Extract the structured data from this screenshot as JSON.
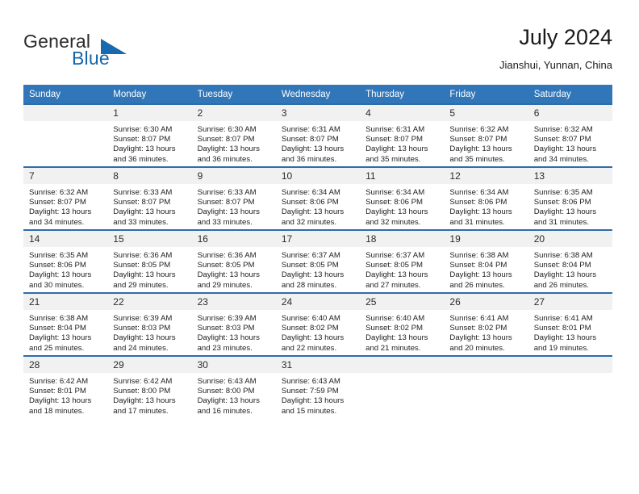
{
  "brand": {
    "word1": "General",
    "word2": "Blue",
    "triangle_color": "#1769b0"
  },
  "header": {
    "title": "July 2024",
    "location": "Jianshui, Yunnan, China"
  },
  "theme": {
    "header_bg": "#3076b8",
    "row_divider": "#2e6da8",
    "daynum_bg": "#f1f1f1",
    "brand_blue": "#1464aa"
  },
  "weekdays": [
    "Sunday",
    "Monday",
    "Tuesday",
    "Wednesday",
    "Thursday",
    "Friday",
    "Saturday"
  ],
  "labels": {
    "sunrise_prefix": "Sunrise: ",
    "sunset_prefix": "Sunset: ",
    "daylight_prefix": "Daylight: "
  },
  "weeks": [
    [
      {
        "day": "",
        "blank": true,
        "sunrise": "",
        "sunset": "",
        "daylight_line1": "",
        "daylight_line2": ""
      },
      {
        "day": "1",
        "sunrise": "Sunrise: 6:30 AM",
        "sunset": "Sunset: 8:07 PM",
        "daylight_line1": "Daylight: 13 hours",
        "daylight_line2": "and 36 minutes."
      },
      {
        "day": "2",
        "sunrise": "Sunrise: 6:30 AM",
        "sunset": "Sunset: 8:07 PM",
        "daylight_line1": "Daylight: 13 hours",
        "daylight_line2": "and 36 minutes."
      },
      {
        "day": "3",
        "sunrise": "Sunrise: 6:31 AM",
        "sunset": "Sunset: 8:07 PM",
        "daylight_line1": "Daylight: 13 hours",
        "daylight_line2": "and 36 minutes."
      },
      {
        "day": "4",
        "sunrise": "Sunrise: 6:31 AM",
        "sunset": "Sunset: 8:07 PM",
        "daylight_line1": "Daylight: 13 hours",
        "daylight_line2": "and 35 minutes."
      },
      {
        "day": "5",
        "sunrise": "Sunrise: 6:32 AM",
        "sunset": "Sunset: 8:07 PM",
        "daylight_line1": "Daylight: 13 hours",
        "daylight_line2": "and 35 minutes."
      },
      {
        "day": "6",
        "sunrise": "Sunrise: 6:32 AM",
        "sunset": "Sunset: 8:07 PM",
        "daylight_line1": "Daylight: 13 hours",
        "daylight_line2": "and 34 minutes."
      }
    ],
    [
      {
        "day": "7",
        "sunrise": "Sunrise: 6:32 AM",
        "sunset": "Sunset: 8:07 PM",
        "daylight_line1": "Daylight: 13 hours",
        "daylight_line2": "and 34 minutes."
      },
      {
        "day": "8",
        "sunrise": "Sunrise: 6:33 AM",
        "sunset": "Sunset: 8:07 PM",
        "daylight_line1": "Daylight: 13 hours",
        "daylight_line2": "and 33 minutes."
      },
      {
        "day": "9",
        "sunrise": "Sunrise: 6:33 AM",
        "sunset": "Sunset: 8:07 PM",
        "daylight_line1": "Daylight: 13 hours",
        "daylight_line2": "and 33 minutes."
      },
      {
        "day": "10",
        "sunrise": "Sunrise: 6:34 AM",
        "sunset": "Sunset: 8:06 PM",
        "daylight_line1": "Daylight: 13 hours",
        "daylight_line2": "and 32 minutes."
      },
      {
        "day": "11",
        "sunrise": "Sunrise: 6:34 AM",
        "sunset": "Sunset: 8:06 PM",
        "daylight_line1": "Daylight: 13 hours",
        "daylight_line2": "and 32 minutes."
      },
      {
        "day": "12",
        "sunrise": "Sunrise: 6:34 AM",
        "sunset": "Sunset: 8:06 PM",
        "daylight_line1": "Daylight: 13 hours",
        "daylight_line2": "and 31 minutes."
      },
      {
        "day": "13",
        "sunrise": "Sunrise: 6:35 AM",
        "sunset": "Sunset: 8:06 PM",
        "daylight_line1": "Daylight: 13 hours",
        "daylight_line2": "and 31 minutes."
      }
    ],
    [
      {
        "day": "14",
        "sunrise": "Sunrise: 6:35 AM",
        "sunset": "Sunset: 8:06 PM",
        "daylight_line1": "Daylight: 13 hours",
        "daylight_line2": "and 30 minutes."
      },
      {
        "day": "15",
        "sunrise": "Sunrise: 6:36 AM",
        "sunset": "Sunset: 8:05 PM",
        "daylight_line1": "Daylight: 13 hours",
        "daylight_line2": "and 29 minutes."
      },
      {
        "day": "16",
        "sunrise": "Sunrise: 6:36 AM",
        "sunset": "Sunset: 8:05 PM",
        "daylight_line1": "Daylight: 13 hours",
        "daylight_line2": "and 29 minutes."
      },
      {
        "day": "17",
        "sunrise": "Sunrise: 6:37 AM",
        "sunset": "Sunset: 8:05 PM",
        "daylight_line1": "Daylight: 13 hours",
        "daylight_line2": "and 28 minutes."
      },
      {
        "day": "18",
        "sunrise": "Sunrise: 6:37 AM",
        "sunset": "Sunset: 8:05 PM",
        "daylight_line1": "Daylight: 13 hours",
        "daylight_line2": "and 27 minutes."
      },
      {
        "day": "19",
        "sunrise": "Sunrise: 6:38 AM",
        "sunset": "Sunset: 8:04 PM",
        "daylight_line1": "Daylight: 13 hours",
        "daylight_line2": "and 26 minutes."
      },
      {
        "day": "20",
        "sunrise": "Sunrise: 6:38 AM",
        "sunset": "Sunset: 8:04 PM",
        "daylight_line1": "Daylight: 13 hours",
        "daylight_line2": "and 26 minutes."
      }
    ],
    [
      {
        "day": "21",
        "sunrise": "Sunrise: 6:38 AM",
        "sunset": "Sunset: 8:04 PM",
        "daylight_line1": "Daylight: 13 hours",
        "daylight_line2": "and 25 minutes."
      },
      {
        "day": "22",
        "sunrise": "Sunrise: 6:39 AM",
        "sunset": "Sunset: 8:03 PM",
        "daylight_line1": "Daylight: 13 hours",
        "daylight_line2": "and 24 minutes."
      },
      {
        "day": "23",
        "sunrise": "Sunrise: 6:39 AM",
        "sunset": "Sunset: 8:03 PM",
        "daylight_line1": "Daylight: 13 hours",
        "daylight_line2": "and 23 minutes."
      },
      {
        "day": "24",
        "sunrise": "Sunrise: 6:40 AM",
        "sunset": "Sunset: 8:02 PM",
        "daylight_line1": "Daylight: 13 hours",
        "daylight_line2": "and 22 minutes."
      },
      {
        "day": "25",
        "sunrise": "Sunrise: 6:40 AM",
        "sunset": "Sunset: 8:02 PM",
        "daylight_line1": "Daylight: 13 hours",
        "daylight_line2": "and 21 minutes."
      },
      {
        "day": "26",
        "sunrise": "Sunrise: 6:41 AM",
        "sunset": "Sunset: 8:02 PM",
        "daylight_line1": "Daylight: 13 hours",
        "daylight_line2": "and 20 minutes."
      },
      {
        "day": "27",
        "sunrise": "Sunrise: 6:41 AM",
        "sunset": "Sunset: 8:01 PM",
        "daylight_line1": "Daylight: 13 hours",
        "daylight_line2": "and 19 minutes."
      }
    ],
    [
      {
        "day": "28",
        "sunrise": "Sunrise: 6:42 AM",
        "sunset": "Sunset: 8:01 PM",
        "daylight_line1": "Daylight: 13 hours",
        "daylight_line2": "and 18 minutes."
      },
      {
        "day": "29",
        "sunrise": "Sunrise: 6:42 AM",
        "sunset": "Sunset: 8:00 PM",
        "daylight_line1": "Daylight: 13 hours",
        "daylight_line2": "and 17 minutes."
      },
      {
        "day": "30",
        "sunrise": "Sunrise: 6:43 AM",
        "sunset": "Sunset: 8:00 PM",
        "daylight_line1": "Daylight: 13 hours",
        "daylight_line2": "and 16 minutes."
      },
      {
        "day": "31",
        "sunrise": "Sunrise: 6:43 AM",
        "sunset": "Sunset: 7:59 PM",
        "daylight_line1": "Daylight: 13 hours",
        "daylight_line2": "and 15 minutes."
      },
      {
        "day": "",
        "blank": true,
        "sunrise": "",
        "sunset": "",
        "daylight_line1": "",
        "daylight_line2": ""
      },
      {
        "day": "",
        "blank": true,
        "sunrise": "",
        "sunset": "",
        "daylight_line1": "",
        "daylight_line2": ""
      },
      {
        "day": "",
        "blank": true,
        "sunrise": "",
        "sunset": "",
        "daylight_line1": "",
        "daylight_line2": ""
      }
    ]
  ]
}
